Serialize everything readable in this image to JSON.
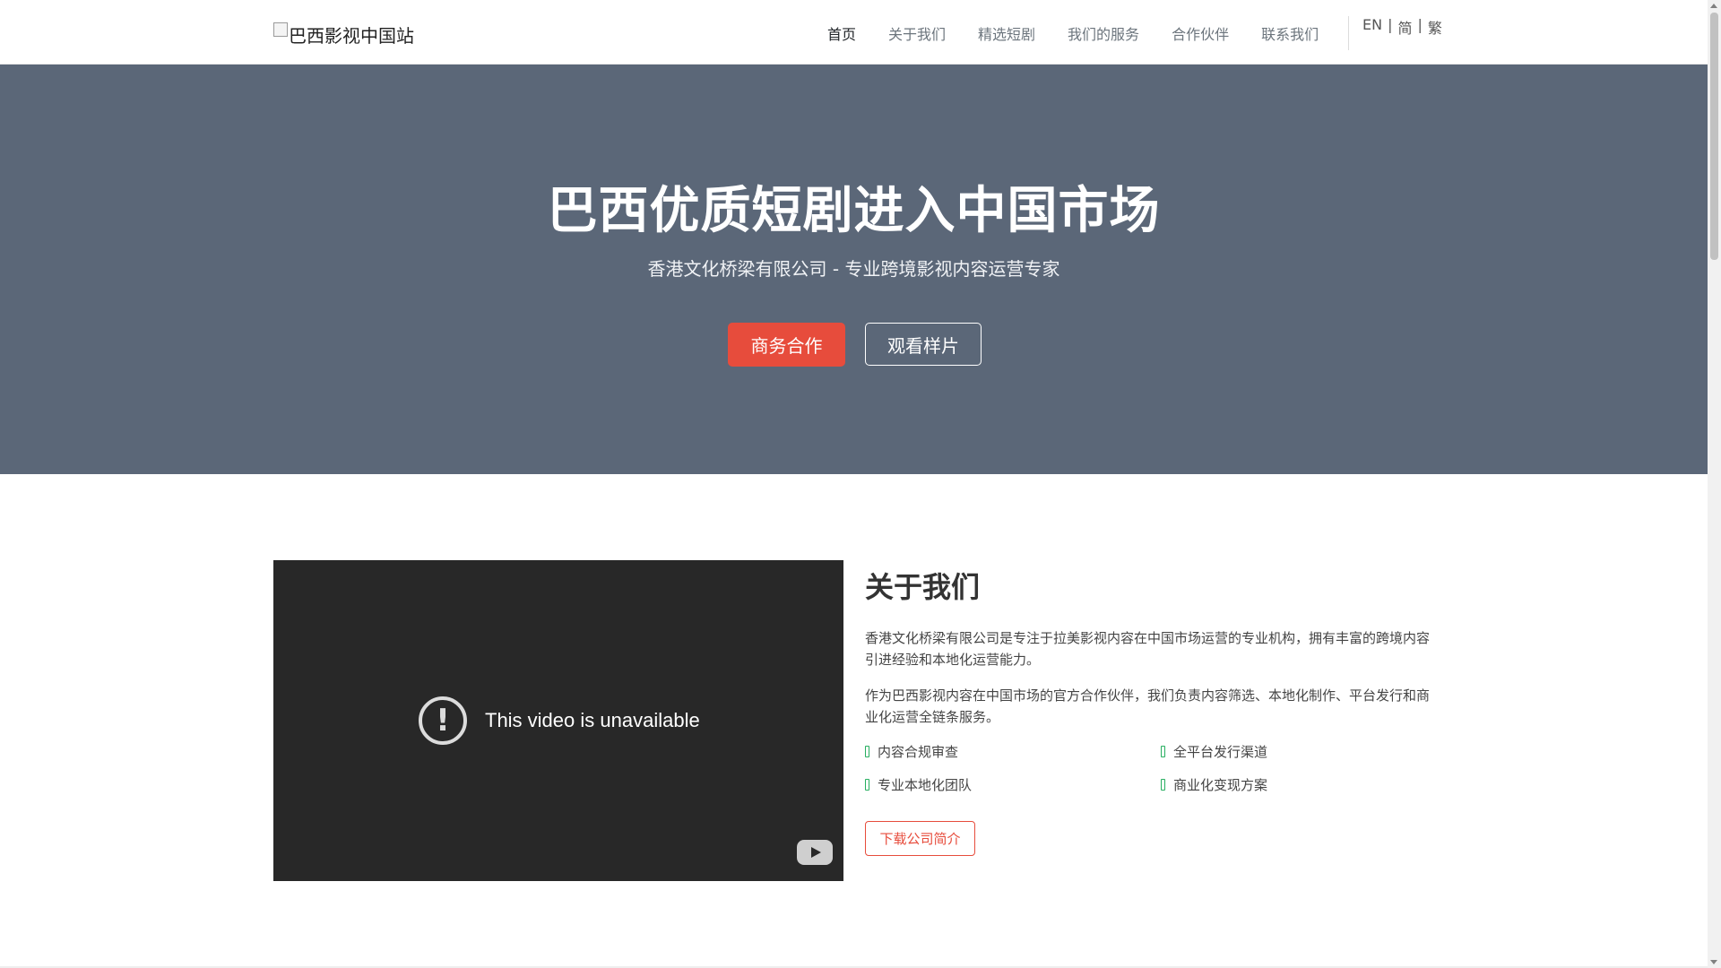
{
  "navbar": {
    "brand_text": "巴西影视中国站",
    "links": [
      {
        "label": "首页",
        "active": true
      },
      {
        "label": "关于我们",
        "active": false
      },
      {
        "label": "精选短剧",
        "active": false
      },
      {
        "label": "我们的服务",
        "active": false
      },
      {
        "label": "合作伙伴",
        "active": false
      },
      {
        "label": "联系我们",
        "active": false
      }
    ],
    "languages": {
      "en": "EN",
      "separator": "|",
      "simplified": "简",
      "traditional": "繁"
    }
  },
  "hero": {
    "title": "巴西优质短剧进入中国市场",
    "subtitle": "香港文化桥梁有限公司 - 专业跨境影视内容运营专家",
    "primary_button": "商务合作",
    "secondary_button": "观看样片"
  },
  "video": {
    "message": "This video is unavailable",
    "icon": "alert-circle-icon",
    "logo_icon": "youtube-icon"
  },
  "about": {
    "heading": "关于我们",
    "paragraphs": [
      "香港文化桥梁有限公司是专注于拉美影视内容在中国市场运营的专业机构，拥有丰富的跨境内容引进经验和本地化运营能力。",
      "作为巴西影视内容在中国市场的官方合作伙伴，我们负责内容筛选、本地化制作、平台发行和商业化运营全链条服务。"
    ],
    "features": [
      "内容合规审查",
      "全平台发行渠道",
      "专业本地化团队",
      "商业化变现方案"
    ],
    "download_button": "下载公司简介"
  },
  "colors": {
    "accent": "#e74c3c",
    "hero_bg": "#5b6778",
    "check": "#27ae60",
    "video_bg": "#282828"
  }
}
